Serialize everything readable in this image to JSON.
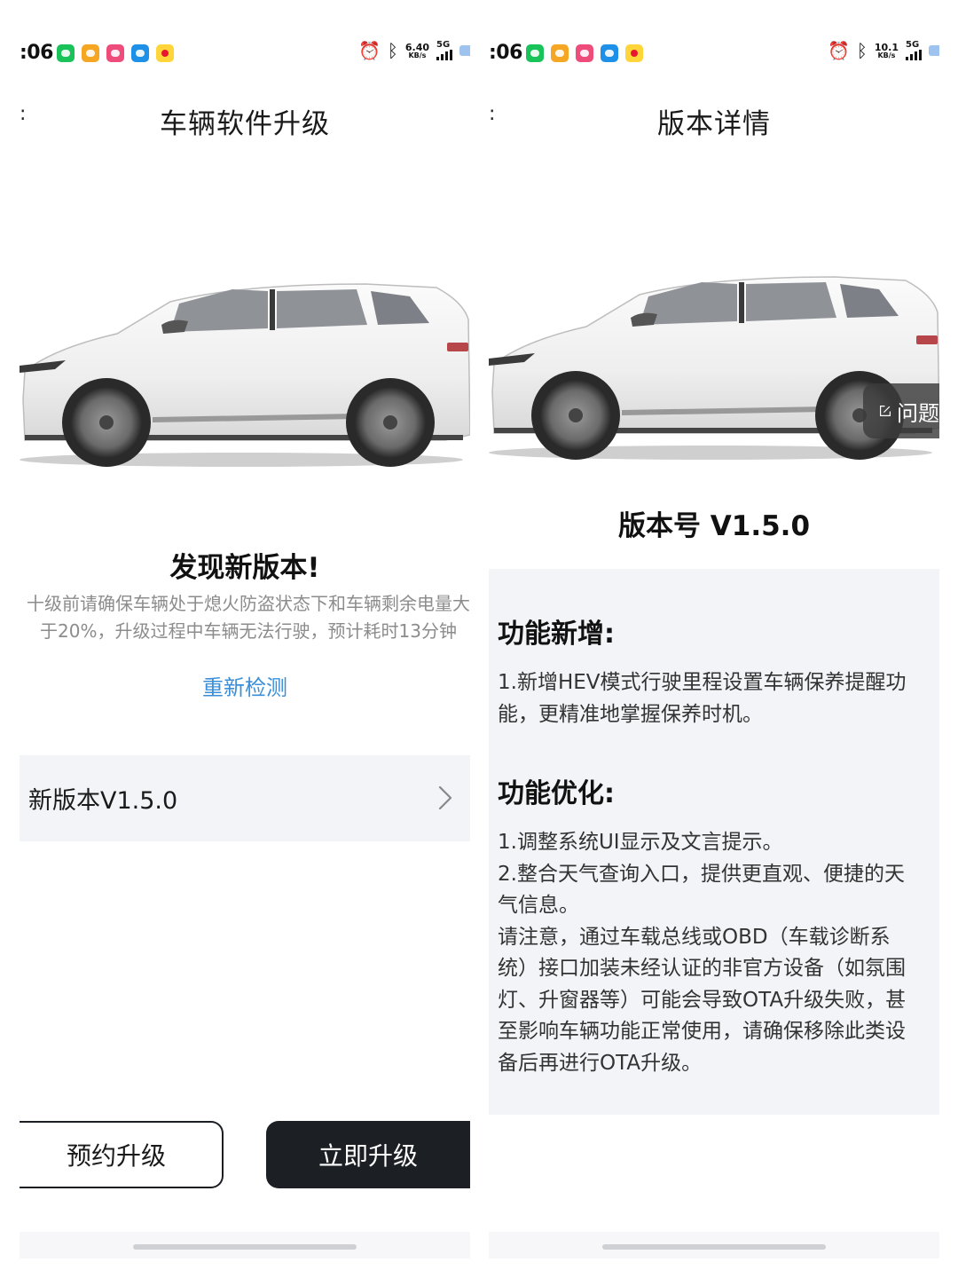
{
  "left": {
    "statusbar": {
      "time": ":06",
      "net_speed": "6.40",
      "net_unit": "KB/s",
      "network": "5G"
    },
    "title": "车辆软件升级",
    "found_title": "发现新版本!",
    "notice_line1": "十级前请确保车辆处于熄火防盗状态下和车辆剩余电量大",
    "notice_line2": "于20%，升级过程中车辆无法行驶，预计耗时13分钟",
    "recheck": "重新检测",
    "version_row": "新版本V1.5.0",
    "buttons": {
      "schedule": "预约升级",
      "now": "立即升级"
    }
  },
  "right": {
    "statusbar": {
      "time": ":06",
      "net_speed": "10.1",
      "net_unit": "KB/s",
      "network": "5G"
    },
    "title": "版本详情",
    "feedback": "问题",
    "version_number": "版本号 V1.5.0",
    "section_new": {
      "title": "功能新增:",
      "lines": [
        "1.新增HEV模式行驶里程设置车辆保养提醒功",
        "能，更精准地掌握保养时机。"
      ]
    },
    "section_opt": {
      "title": "功能优化:",
      "lines": [
        "1.调整系统UI显示及文言提示。",
        "2.整合天气查询入口，提供更直观、便捷的天",
        "气信息。",
        "请注意，通过车载总线或OBD（车载诊断系",
        "统）接口加装未经认证的非官方设备（如氛围",
        "灯、升窗器等）可能会导致OTA升级失败，甚",
        "至影响车辆功能正常使用，请确保移除此类设",
        "备后再进行OTA升级。"
      ]
    }
  },
  "colors": {
    "accent_link": "#3a8fd8",
    "primary_button": "#1c1f24",
    "card_bg": "#f3f4f8"
  },
  "icons": [
    "wechat-icon",
    "app-orange-icon",
    "app-pink-icon",
    "app-blue-icon",
    "weibo-icon",
    "alarm-icon",
    "bluetooth-icon",
    "signal-icon",
    "battery-icon",
    "chevron-right-icon",
    "edit-icon"
  ]
}
